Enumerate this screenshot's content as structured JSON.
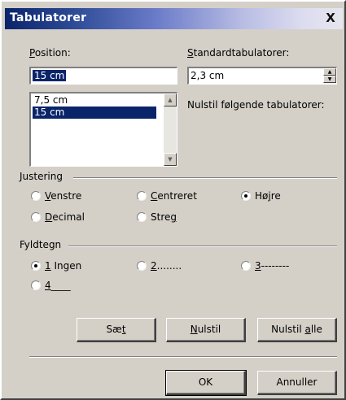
{
  "window": {
    "title": "Tabulatorer",
    "close_label": "X"
  },
  "position": {
    "label_first": "P",
    "label_rest": "osition:",
    "value": "15 cm",
    "list": [
      "7,5 cm",
      "15 cm"
    ],
    "selected_index": 1
  },
  "standard": {
    "label_first": "S",
    "label_rest": "tandardtabulatorer:",
    "value": "2,3 cm",
    "reset_text": "Nulstil følgende tabulatorer:"
  },
  "alignment": {
    "title": "Justering",
    "options": [
      {
        "pre": "",
        "key": "V",
        "post": "enstre",
        "checked": false
      },
      {
        "pre": "",
        "key": "C",
        "post": "entreret",
        "checked": false
      },
      {
        "pre": "Hø",
        "key": "j",
        "post": "re",
        "checked": true
      },
      {
        "pre": "",
        "key": "D",
        "post": "ecimal",
        "checked": false
      },
      {
        "pre": "Stre",
        "key": "g",
        "post": "",
        "checked": false
      }
    ]
  },
  "leader": {
    "title": "Fyldtegn",
    "options": [
      {
        "key": "1",
        "post": " Ingen",
        "checked": true
      },
      {
        "key": "2",
        "post": "........",
        "checked": false
      },
      {
        "key": "3",
        "post": "--------",
        "checked": false
      },
      {
        "key": "4",
        "post": "____",
        "checked": false
      }
    ]
  },
  "buttons": {
    "set": {
      "pre": "Sæ",
      "key": "t",
      "post": ""
    },
    "clear": {
      "pre": "",
      "key": "N",
      "post": "ulstil"
    },
    "clear_all": {
      "pre": "Nulstil ",
      "key": "a",
      "post": "lle"
    },
    "ok": "OK",
    "cancel": "Annuller"
  }
}
